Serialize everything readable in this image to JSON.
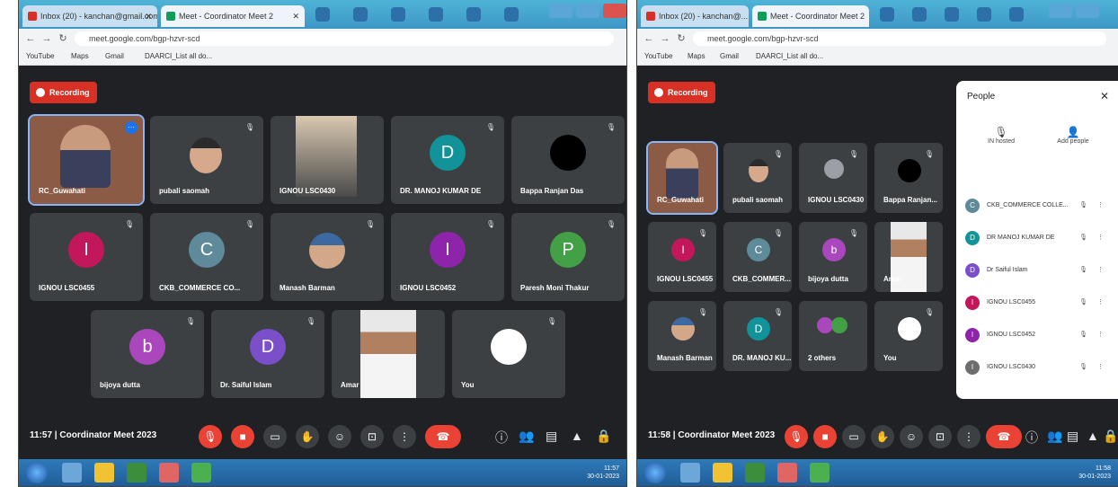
{
  "left": {
    "browser": {
      "tabs": [
        "Inbox (20) - kanchan@gmail.com",
        "Meet - Coordinator Meet 2"
      ],
      "url": "meet.google.com/bgp-hzvr-scd",
      "bookmarks": [
        "YouTube",
        "Maps",
        "Gmail",
        "DAARCI_List all do..."
      ]
    },
    "recording": "Recording",
    "tiles": [
      {
        "name": "RC_Guwahati",
        "kind": "photo"
      },
      {
        "name": "pubali saomah",
        "kind": "photo"
      },
      {
        "name": "IGNOU LSC0430",
        "kind": "photo"
      },
      {
        "name": "DR. MANOJ KUMAR DE",
        "initial": "D",
        "color": "#12939a"
      },
      {
        "name": "Bappa Ranjan Das",
        "kind": "dark"
      },
      {
        "name": "IGNOU LSC0455",
        "initial": "I",
        "color": "#c2185b"
      },
      {
        "name": "CKB_COMMERCE CO...",
        "initial": "C",
        "color": "#5f8a9a"
      },
      {
        "name": "Manash Barman",
        "kind": "photo"
      },
      {
        "name": "IGNOU LSC0452",
        "initial": "I",
        "color": "#8e24aa"
      },
      {
        "name": "Paresh Moni Thakur",
        "initial": "P",
        "color": "#43a047"
      },
      {
        "name": "bijoya dutta",
        "initial": "b",
        "color": "#ab47bc"
      },
      {
        "name": "Dr. Saiful Islam",
        "initial": "D",
        "color": "#7b4fc9"
      },
      {
        "name": "Amar",
        "kind": "photo"
      },
      {
        "name": "You",
        "kind": "you"
      }
    ],
    "time": "11:57",
    "meeting_title": "Coordinator Meet 2023",
    "tray_time": "11:57",
    "tray_date": "30-01-2023"
  },
  "right": {
    "browser": {
      "tabs": [
        "Inbox (20) - kanchan@...",
        "Meet - Coordinator Meet 2"
      ],
      "url": "meet.google.com/bgp-hzvr-scd",
      "bookmarks": [
        "YouTube",
        "Maps",
        "Gmail",
        "DAARCI_List all do..."
      ]
    },
    "recording": "Recording",
    "tiles": [
      {
        "name": "RC_Guwahati",
        "kind": "photo"
      },
      {
        "name": "pubali saomah",
        "kind": "photo"
      },
      {
        "name": "IGNOU LSC0430",
        "kind": "photo"
      },
      {
        "name": "Bappa Ranjan...",
        "kind": "dark"
      },
      {
        "name": "IGNOU LSC0455",
        "initial": "I",
        "color": "#c2185b"
      },
      {
        "name": "CKB_COMMER...",
        "initial": "C",
        "color": "#5f8a9a"
      },
      {
        "name": "bijoya dutta",
        "initial": "b",
        "color": "#ab47bc"
      },
      {
        "name": "Amar",
        "kind": "photo"
      },
      {
        "name": "Manash Barman",
        "kind": "photo"
      },
      {
        "name": "DR. MANOJ KU...",
        "initial": "D",
        "color": "#12939a"
      },
      {
        "name": "2 others",
        "kind": "others"
      },
      {
        "name": "You",
        "kind": "you"
      }
    ],
    "people_panel": {
      "title": "People",
      "actions": [
        "IN hosted",
        "Add people"
      ],
      "rows": [
        {
          "name": "CKB_COMMERCE COLLE...",
          "initial": "C",
          "color": "#5f8a9a"
        },
        {
          "name": "DR MANOJ KUMAR DE",
          "initial": "D",
          "color": "#12939a"
        },
        {
          "name": "Dr Saiful Islam",
          "initial": "D",
          "color": "#7b4fc9"
        },
        {
          "name": "IGNOU LSC0455",
          "initial": "I",
          "color": "#c2185b"
        },
        {
          "name": "IGNOU LSC0452",
          "initial": "I",
          "color": "#8e24aa"
        },
        {
          "name": "IGNOU LSC0430",
          "initial": "I",
          "color": "#6d6d6d"
        }
      ]
    },
    "time": "11:58",
    "meeting_title": "Coordinator Meet 2023",
    "tray_time": "11:58",
    "tray_date": "30-01-2023"
  }
}
